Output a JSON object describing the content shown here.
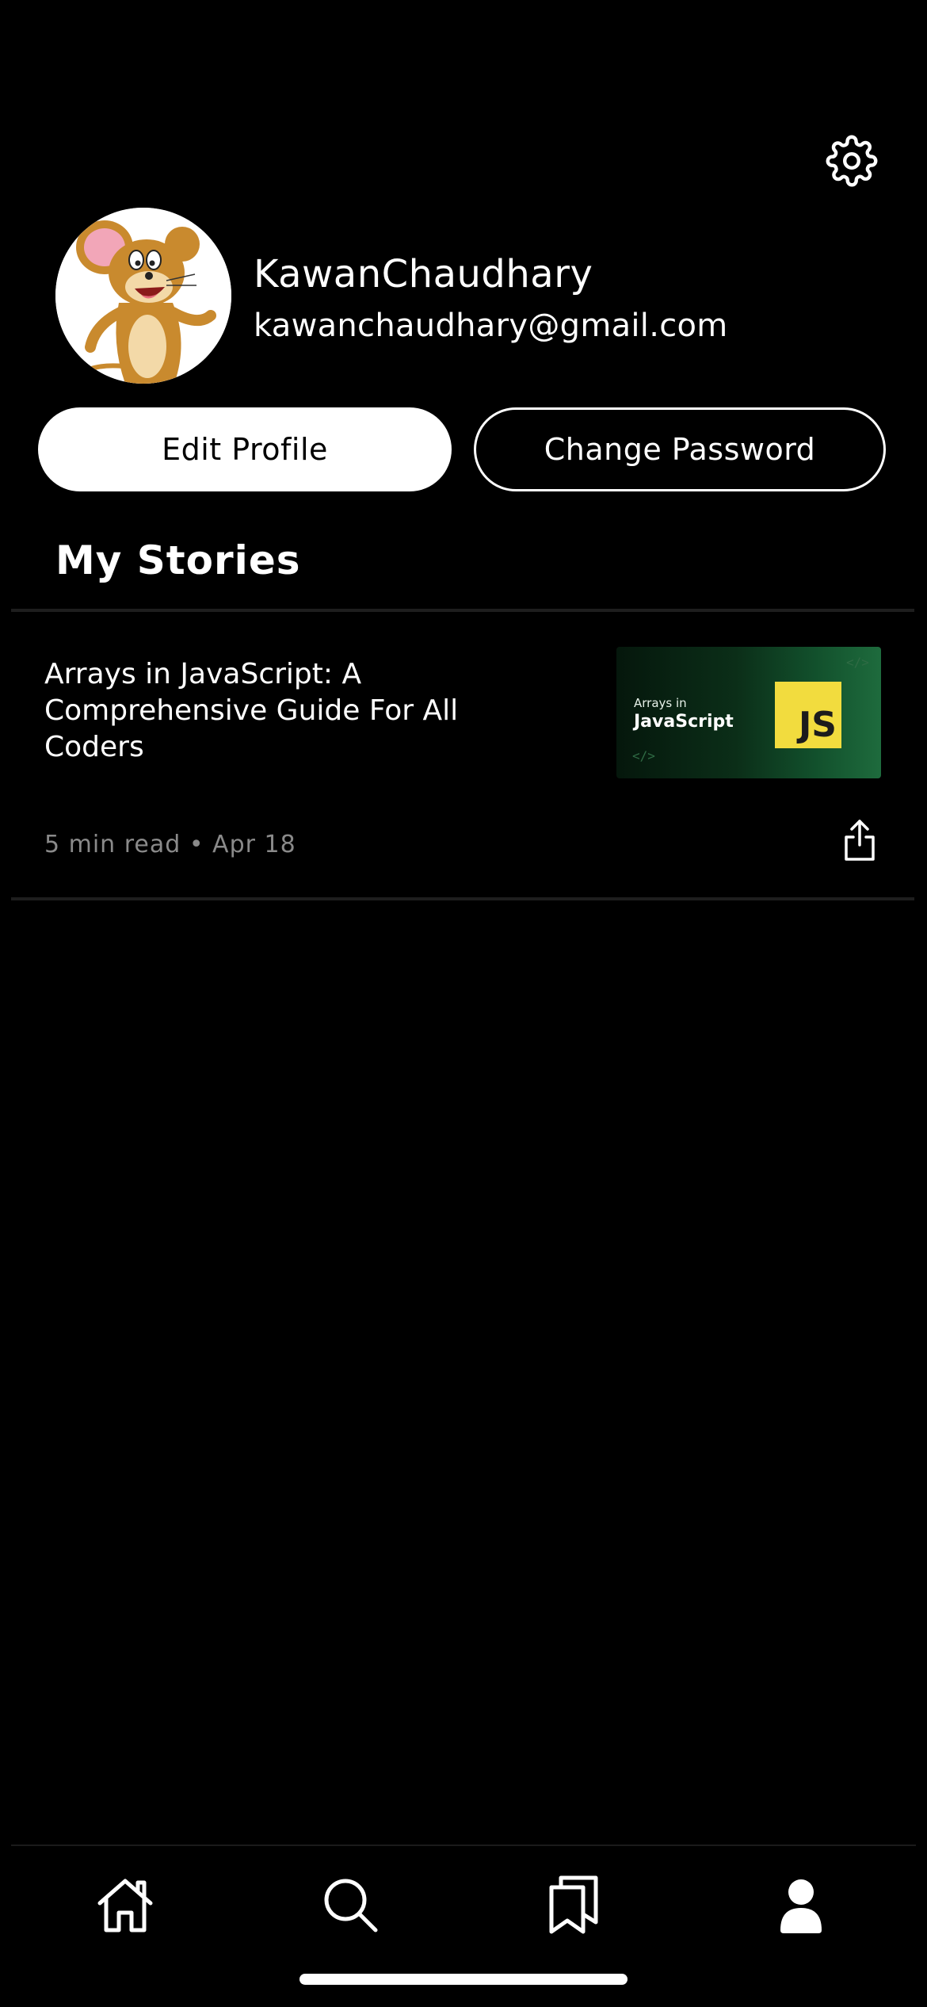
{
  "header": {
    "settings_icon": "gear-icon"
  },
  "profile": {
    "avatar_icon": "cartoon-mouse-avatar",
    "name": "KawanChaudhary",
    "email": "kawanchaudhary@gmail.com"
  },
  "actions": {
    "edit_label": "Edit Profile",
    "change_password_label": "Change Password"
  },
  "stories": {
    "section_title": "My Stories",
    "items": [
      {
        "title": "Arrays in JavaScript: A Comprehensive Guide For All Coders",
        "thumbnail": {
          "caption_small": "Arrays in",
          "caption_big": "JavaScript",
          "badge": "JS",
          "code_marks": [
            "</>",
            "</>"
          ]
        },
        "meta": "5 min read • Apr 18",
        "share_icon": "share-icon"
      }
    ]
  },
  "bottom_nav": {
    "items": [
      {
        "icon": "home-icon"
      },
      {
        "icon": "search-icon"
      },
      {
        "icon": "bookmarks-icon"
      },
      {
        "icon": "profile-icon"
      }
    ]
  },
  "colors": {
    "background": "#000000",
    "text": "#ffffff",
    "meta_text": "#8a8a8a",
    "divider": "#1e1e1e",
    "js_badge": "#f2dc3e"
  }
}
